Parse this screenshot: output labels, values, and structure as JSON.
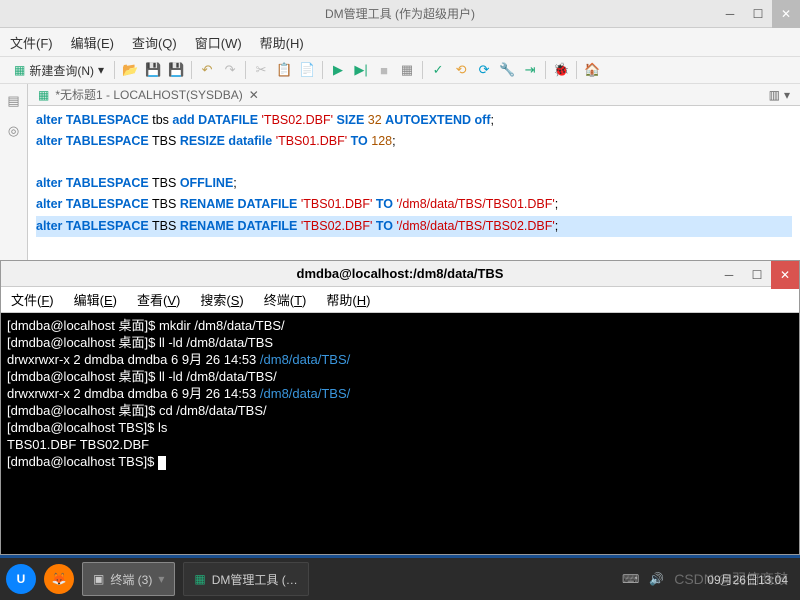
{
  "ide": {
    "title": "DM管理工具  (作为超级用户)",
    "menu": [
      "文件(F)",
      "编辑(E)",
      "查询(Q)",
      "窗口(W)",
      "帮助(H)"
    ],
    "newQuery": "新建查询(N)",
    "tab": "*无标题1 - LOCALHOST(SYSDBA)",
    "sql": {
      "l1": {
        "kw": "alter TABLESPACE",
        "id": "tbs",
        "kw2": "add DATAFILE",
        "str": "'TBS02.DBF'",
        "kw3": "SIZE",
        "num": "32",
        "kw4": "AUTOEXTEND off",
        "semi": ";"
      },
      "l2": {
        "kw": "alter TABLESPACE",
        "id": "TBS",
        "kw2": "RESIZE datafile",
        "str": "'TBS01.DBF'",
        "kw3": "TO",
        "num": "128",
        "semi": ";"
      },
      "l4": {
        "kw": "alter TABLESPACE",
        "id": "TBS",
        "kw2": "OFFLINE",
        "semi": ";"
      },
      "l5": {
        "kw": "alter TABLESPACE",
        "id": "TBS",
        "kw2": "RENAME DATAFILE",
        "str": "'TBS01.DBF'",
        "kw3": "TO",
        "str2": "'/dm8/data/TBS/TBS01.DBF'",
        "semi": ";"
      },
      "l6": {
        "kw": "alter TABLESPACE",
        "id": "TBS",
        "kw2": "RENAME DATAFILE",
        "str": "'TBS02.DBF'",
        "kw3": "TO",
        "str2": "'/dm8/data/TBS/TBS02.DBF'",
        "semi": ";"
      }
    }
  },
  "term": {
    "title": "dmdba@localhost:/dm8/data/TBS",
    "menu": [
      "文件(F)",
      "编辑(E)",
      "查看(V)",
      "搜索(S)",
      "终端(T)",
      "帮助(H)"
    ],
    "lines": [
      {
        "prompt": "[dmdba@localhost 桌面]$ ",
        "cmd": "mkdir /dm8/data/TBS/"
      },
      {
        "prompt": "[dmdba@localhost 桌面]$ ",
        "cmd": "ll -ld /dm8/data/TBS"
      },
      {
        "text": "drwxrwxr-x 2 dmdba dmdba 6  9月  26 14:53 ",
        "path": "/dm8/data/TBS/"
      },
      {
        "prompt": "[dmdba@localhost 桌面]$ ",
        "cmd": "ll -ld /dm8/data/TBS/"
      },
      {
        "text": "drwxrwxr-x 2 dmdba dmdba 6  9月  26 14:53 ",
        "path": "/dm8/data/TBS/"
      },
      {
        "prompt": "[dmdba@localhost 桌面]$ ",
        "cmd": "cd /dm8/data/TBS/"
      },
      {
        "prompt": "[dmdba@localhost TBS]$ ",
        "cmd": "ls"
      },
      {
        "text": "TBS01.DBF  TBS02.DBF"
      },
      {
        "prompt": "[dmdba@localhost TBS]$ ",
        "cursor": true
      }
    ]
  },
  "taskbar": {
    "terminalLabel": "终端 (3)",
    "dmLabel": "DM管理工具 (…",
    "watermark": "CSDN @羽俯商鼓",
    "time": "09月26日13:04"
  }
}
